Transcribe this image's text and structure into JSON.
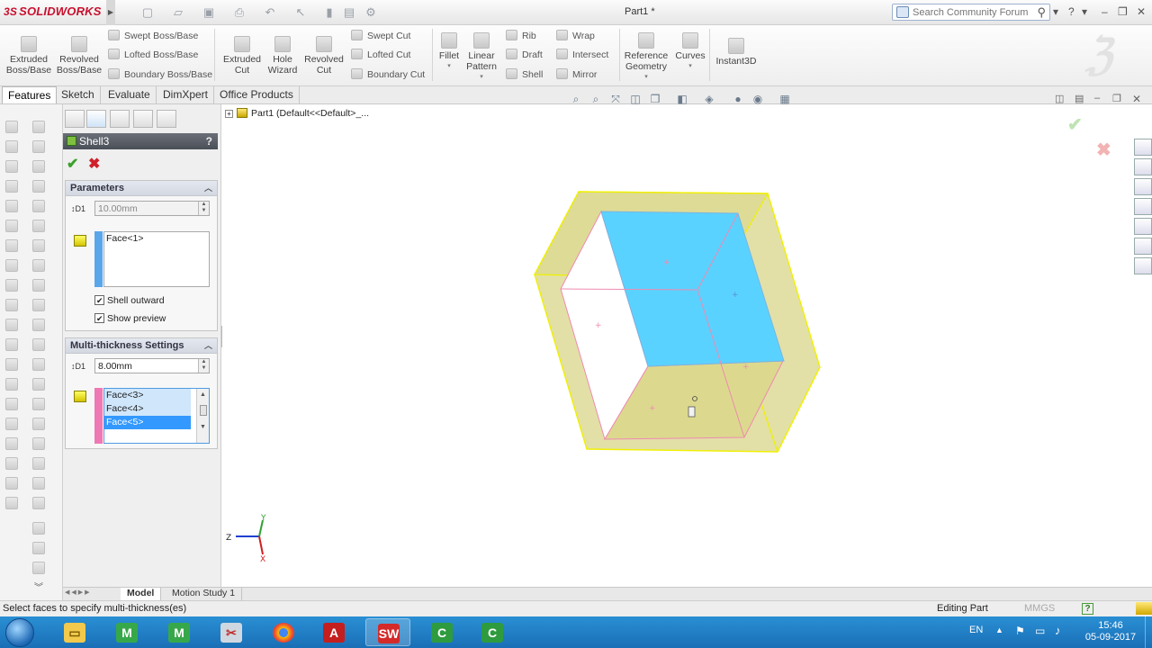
{
  "app": {
    "brand": "SOLIDWORKS",
    "brand_prefix": "3S",
    "doc_title": "Part1 *",
    "search_placeholder": "Search Community Forum"
  },
  "ribbon": {
    "big_buttons": [
      {
        "label1": "Extruded",
        "label2": "Boss/Base"
      },
      {
        "label1": "Revolved",
        "label2": "Boss/Base"
      }
    ],
    "boss_small": [
      "Swept Boss/Base",
      "Lofted Boss/Base",
      "Boundary Boss/Base"
    ],
    "cut_big": [
      {
        "label1": "Extruded",
        "label2": "Cut"
      },
      {
        "label1": "Hole",
        "label2": "Wizard"
      },
      {
        "label1": "Revolved",
        "label2": "Cut"
      }
    ],
    "cut_small": [
      "Swept Cut",
      "Lofted Cut",
      "Boundary Cut"
    ],
    "fillet": "Fillet",
    "linear_pattern": {
      "label1": "Linear",
      "label2": "Pattern"
    },
    "features_small_a": [
      "Rib",
      "Draft",
      "Shell"
    ],
    "features_small_b": [
      "Wrap",
      "Intersect",
      "Mirror"
    ],
    "reference_geometry": {
      "label1": "Reference",
      "label2": "Geometry"
    },
    "curves": "Curves",
    "instant3d": "Instant3D"
  },
  "tabs": [
    "Features",
    "Sketch",
    "Evaluate",
    "DimXpert",
    "Office Products"
  ],
  "property_manager": {
    "title": "Shell3",
    "help": "?",
    "parameters": {
      "heading": "Parameters",
      "thickness": "10.00mm",
      "faces": [
        "Face<1>"
      ],
      "shell_outward": "Shell outward",
      "show_preview": "Show preview"
    },
    "multi": {
      "heading": "Multi-thickness Settings",
      "thickness": "8.00mm",
      "faces": [
        "Face<3>",
        "Face<4>",
        "Face<5>"
      ],
      "selected_index": 2
    },
    "dim_label": "D1"
  },
  "tree": {
    "root": "Part1  (Default<<Default>_..."
  },
  "bottom_tabs": [
    "Model",
    "Motion Study 1"
  ],
  "status": {
    "message": "Select faces to specify multi-thickness(es)",
    "mode": "Editing Part",
    "units": "MMGS"
  },
  "tray": {
    "language": "EN",
    "time": "15:46",
    "date": "05-09-2017"
  },
  "triad": {
    "x": "X",
    "y": "Y",
    "z": "Z"
  },
  "colors": {
    "accent_blue": "#3399ff",
    "face_highlight": "#5ad2ff",
    "preview_yellow": "#d8d68a",
    "edge_pink": "#ef8ab0",
    "edge_yellow": "#f0f000",
    "taskbar": "#1f78c1"
  }
}
